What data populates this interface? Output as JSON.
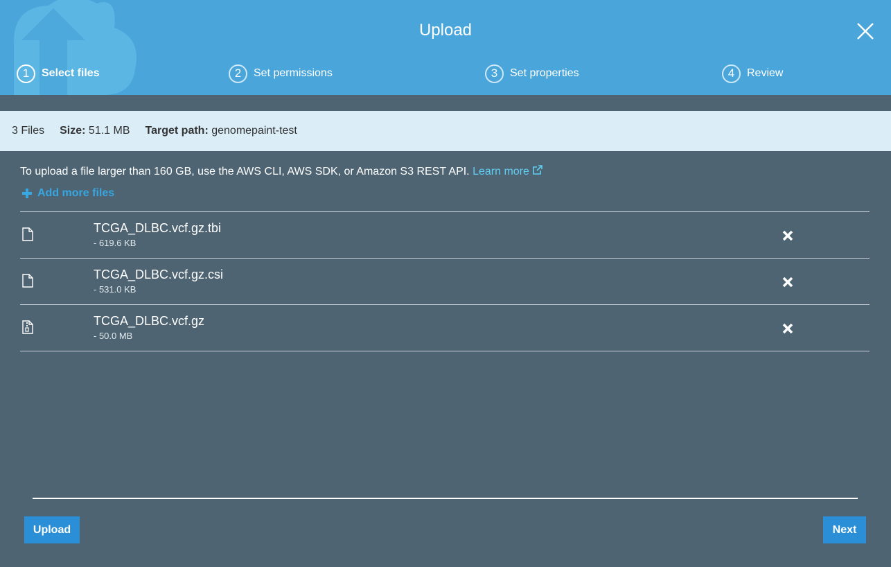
{
  "header": {
    "title": "Upload",
    "steps": [
      {
        "number": "1",
        "label": "Select files",
        "active": true
      },
      {
        "number": "2",
        "label": "Set permissions",
        "active": false
      },
      {
        "number": "3",
        "label": "Set properties",
        "active": false
      },
      {
        "number": "4",
        "label": "Review",
        "active": false
      }
    ],
    "close_icon": "close-icon",
    "art_icon": "cloud-upload-icon"
  },
  "infobar": {
    "files_count": "3 Files",
    "size_label": "Size:",
    "size_value": "51.1 MB",
    "target_label": "Target path:",
    "target_value": "genomepaint-test"
  },
  "notice": {
    "text": "To upload a file larger than 160 GB, use the AWS CLI, AWS SDK, or Amazon S3 REST API.",
    "link_text": "Learn more",
    "link_icon": "external-link-icon"
  },
  "add_more": {
    "label": "Add more files",
    "icon": "plus-icon"
  },
  "files": [
    {
      "name": "TCGA_DLBC.vcf.gz.tbi",
      "size": "- 619.6 KB",
      "icon": "file-icon"
    },
    {
      "name": "TCGA_DLBC.vcf.gz.csi",
      "size": "- 531.0 KB",
      "icon": "file-icon"
    },
    {
      "name": "TCGA_DLBC.vcf.gz",
      "size": "- 50.0 MB",
      "icon": "file-archive-icon"
    }
  ],
  "footer": {
    "upload_label": "Upload",
    "next_label": "Next"
  },
  "colors": {
    "header_bg": "#4aa6da",
    "body_bg": "#4e6472",
    "infobar_bg": "#dbeef8",
    "button_bg": "#2a8fd6",
    "link": "#5fcff5"
  }
}
